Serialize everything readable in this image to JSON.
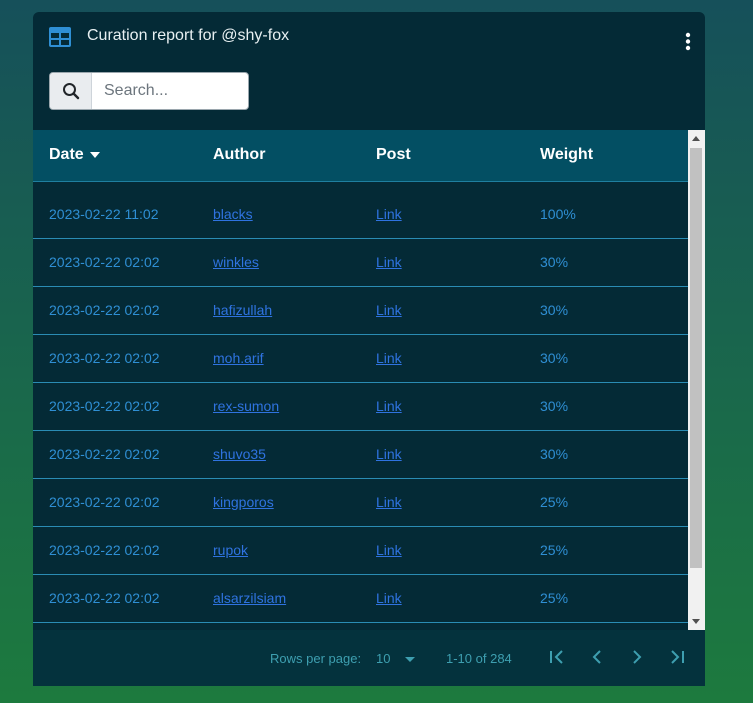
{
  "header": {
    "title": "Curation report for @shy-fox",
    "icon": "table-icon",
    "menu_icon": "more-vertical-icon"
  },
  "search": {
    "icon": "search-icon",
    "placeholder": "Search..."
  },
  "table": {
    "columns": [
      "Date",
      "Author",
      "Post",
      "Weight"
    ],
    "sort_column": "Date",
    "sort_direction": "descending",
    "rows": [
      {
        "date": "2023-02-22 11:02",
        "author": "blacks",
        "post": "Link",
        "weight": "100%"
      },
      {
        "date": "2023-02-22 02:02",
        "author": "winkles",
        "post": "Link",
        "weight": "30%"
      },
      {
        "date": "2023-02-22 02:02",
        "author": "hafizullah",
        "post": "Link",
        "weight": "30%"
      },
      {
        "date": "2023-02-22 02:02",
        "author": "moh.arif",
        "post": "Link",
        "weight": "30%"
      },
      {
        "date": "2023-02-22 02:02",
        "author": "rex-sumon",
        "post": "Link",
        "weight": "30%"
      },
      {
        "date": "2023-02-22 02:02",
        "author": "shuvo35",
        "post": "Link",
        "weight": "30%"
      },
      {
        "date": "2023-02-22 02:02",
        "author": "kingporos",
        "post": "Link",
        "weight": "25%"
      },
      {
        "date": "2023-02-22 02:02",
        "author": "rupok",
        "post": "Link",
        "weight": "25%"
      },
      {
        "date": "2023-02-22 02:02",
        "author": "alsarzilsiam",
        "post": "Link",
        "weight": "25%"
      }
    ]
  },
  "pagination": {
    "rows_per_page_label": "Rows per page:",
    "rows_per_page_value": "10",
    "range_text": "1-10 of 284"
  },
  "colors": {
    "card_bg": "#042a36",
    "header_row_bg": "#034f63",
    "link": "#2f73e0",
    "cell_text": "#2f8fd4"
  }
}
